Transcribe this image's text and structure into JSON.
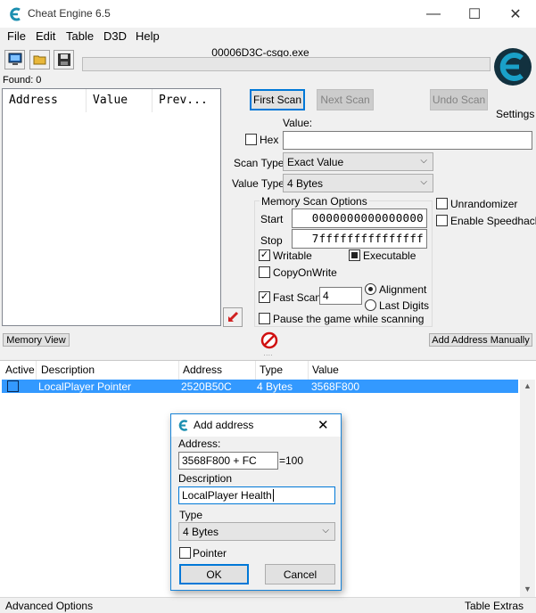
{
  "window": {
    "title": "Cheat Engine 6.5",
    "minimize": "—",
    "maximize": "☐",
    "close": "✕"
  },
  "menu": [
    "File",
    "Edit",
    "Table",
    "D3D",
    "Help"
  ],
  "process_name": "00006D3C-csgo.exe",
  "found_label": "Found: 0",
  "results_columns": [
    "Address",
    "Value",
    "Prev..."
  ],
  "scan_buttons": {
    "first": "First Scan",
    "next": "Next Scan",
    "undo": "Undo Scan"
  },
  "settings_label": "Settings",
  "value": {
    "label": "Value:",
    "hex_label": "Hex",
    "hex_checked": false,
    "input": ""
  },
  "scan_type": {
    "label": "Scan Type",
    "value": "Exact Value"
  },
  "value_type": {
    "label": "Value Type",
    "value": "4 Bytes"
  },
  "memory_options": {
    "title": "Memory Scan Options",
    "start_label": "Start",
    "start_value": "0000000000000000",
    "stop_label": "Stop",
    "stop_value": "7fffffffffffffff",
    "writable": "Writable",
    "writable_checked": true,
    "executable": "Executable",
    "executable_state": "partial",
    "copyonwrite": "CopyOnWrite",
    "copyonwrite_checked": false,
    "fastscan": "Fast Scan",
    "fastscan_checked": true,
    "fastscan_value": "4",
    "alignment": "Alignment",
    "lastdigits": "Last Digits",
    "alignment_selected": true,
    "pause": "Pause the game while scanning",
    "pause_checked": false
  },
  "side_options": {
    "unrandomizer": "Unrandomizer",
    "speedhack": "Enable Speedhack"
  },
  "memory_view_button": "Memory View",
  "add_manually_button": "Add Address Manually",
  "address_table": {
    "columns": [
      "Active",
      "Description",
      "Address",
      "Type",
      "Value"
    ],
    "rows": [
      {
        "active": false,
        "description": "LocalPlayer Pointer",
        "address": "2520B50C",
        "type": "4 Bytes",
        "value": "3568F800"
      }
    ]
  },
  "status": {
    "left": "Advanced Options",
    "right": "Table Extras"
  },
  "dialog": {
    "title": "Add address",
    "close": "✕",
    "address_label": "Address:",
    "address_value": "3568F800 + FC",
    "address_result": "=100",
    "description_label": "Description",
    "description_value": "LocalPlayer Health",
    "type_label": "Type",
    "type_value": "4 Bytes",
    "pointer_label": "Pointer",
    "pointer_checked": false,
    "ok": "OK",
    "cancel": "Cancel"
  },
  "colors": {
    "selection": "#3399ff",
    "accent": "#0078d7",
    "logo": "#1aa0c8"
  }
}
